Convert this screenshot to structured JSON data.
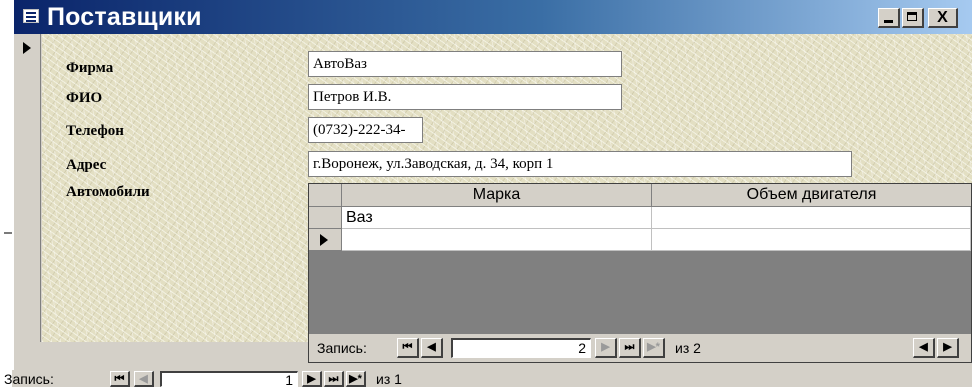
{
  "window": {
    "title": "Поставщики",
    "min_label": "_",
    "close_label": "X"
  },
  "form": {
    "fields": [
      {
        "label": "Фирма",
        "value": "АвтоВаз"
      },
      {
        "label": "ФИО",
        "value": "Петров И.В."
      },
      {
        "label": "Телефон",
        "value": "(0732)-222-34-"
      },
      {
        "label": "Адрес",
        "value": "г.Воронеж, ул.Заводская, д. 34, корп 1"
      }
    ],
    "subform_label": "Автомобили"
  },
  "subform": {
    "columns": [
      "Марка",
      "Объем двигателя"
    ],
    "rows": [
      {
        "marka": "Ваз",
        "engine": ""
      }
    ],
    "nav": {
      "label": "Запись:",
      "current": "2",
      "of_text": "из 2"
    }
  },
  "main_nav": {
    "label": "Запись:",
    "current": "1",
    "of_text": "из 1"
  },
  "icons": {
    "first": "⏮",
    "prev": "◀",
    "next": "▶",
    "last": "⏭",
    "new": "▶*"
  }
}
